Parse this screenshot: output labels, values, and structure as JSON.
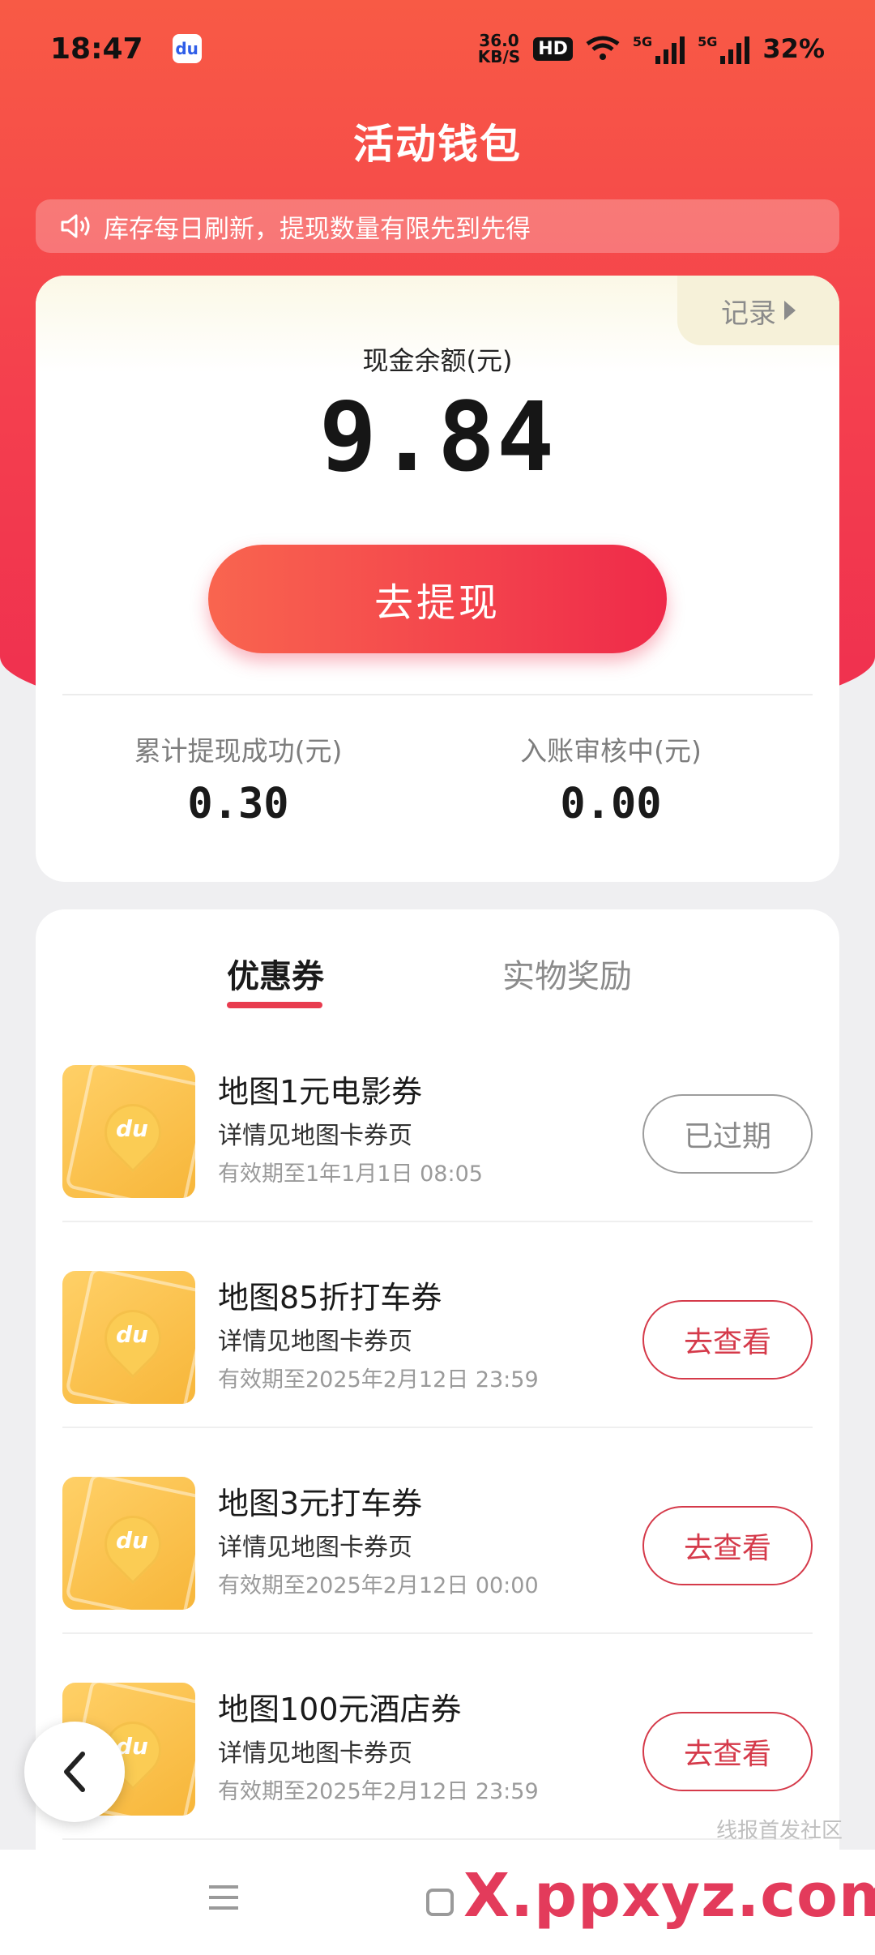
{
  "status_bar": {
    "time": "18:47",
    "app_badge": "du",
    "net_speed_value": "36.0",
    "net_speed_unit": "KB/S",
    "hd": "HD",
    "signal_tag": "5G",
    "battery": "32%"
  },
  "header": {
    "title": "活动钱包"
  },
  "notice": {
    "text": "库存每日刷新，提现数量有限先到先得"
  },
  "balance": {
    "records_label": "记录",
    "label": "现金余额(元)",
    "value": "9.84",
    "withdraw_label": "去提现",
    "stats": [
      {
        "label": "累计提现成功(元)",
        "value": "0.30"
      },
      {
        "label": "入账审核中(元)",
        "value": "0.00"
      }
    ]
  },
  "tabs": [
    {
      "label": "优惠券",
      "active": true
    },
    {
      "label": "实物奖励",
      "active": false
    }
  ],
  "coupons": [
    {
      "title": "地图1元电影券",
      "subtitle": "详情见地图卡券页",
      "expiry": "有效期至1年1月1日 08:05",
      "action": "已过期",
      "status": "expired"
    },
    {
      "title": "地图85折打车券",
      "subtitle": "详情见地图卡券页",
      "expiry": "有效期至2025年2月12日 23:59",
      "action": "去查看",
      "status": "active"
    },
    {
      "title": "地图3元打车券",
      "subtitle": "详情见地图卡券页",
      "expiry": "有效期至2025年2月12日 00:00",
      "action": "去查看",
      "status": "active"
    },
    {
      "title": "地图100元酒店券",
      "subtitle": "详情见地图卡券页",
      "expiry": "有效期至2025年2月12日 23:59",
      "action": "去查看",
      "status": "active"
    }
  ],
  "watermark": {
    "main": "X.ppxyz.com",
    "sub": "线报首发社区"
  },
  "colors": {
    "accent": "#ef2f4f",
    "button_outline": "#d53a4a",
    "expired_outline": "#9d9d9d"
  },
  "icons": [
    "speaker-icon",
    "triangle-right-icon",
    "coupon-du-icon",
    "back-arrow-icon",
    "menu-icon",
    "home-square-icon",
    "wifi-icon",
    "signal-icon"
  ]
}
